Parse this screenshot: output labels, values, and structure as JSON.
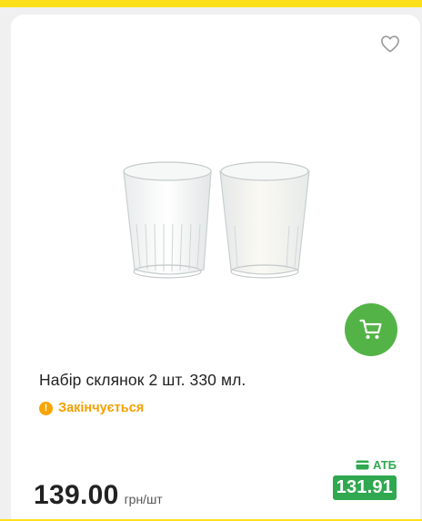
{
  "product": {
    "name": "Набір склянок 2 шт. 330 мл.",
    "status": "Закінчується",
    "status_icon": "!",
    "price": "139.00",
    "unit": "грн/шт",
    "promo_brand": "АТБ",
    "promo_price": "131.91"
  },
  "icons": {
    "favorite": "heart-icon",
    "cart": "cart-icon",
    "card": "card-icon"
  },
  "colors": {
    "brand_yellow": "#ffe01b",
    "cart_green": "#54b347",
    "promo_green": "#2fa84f",
    "status_orange": "#f5a000"
  }
}
